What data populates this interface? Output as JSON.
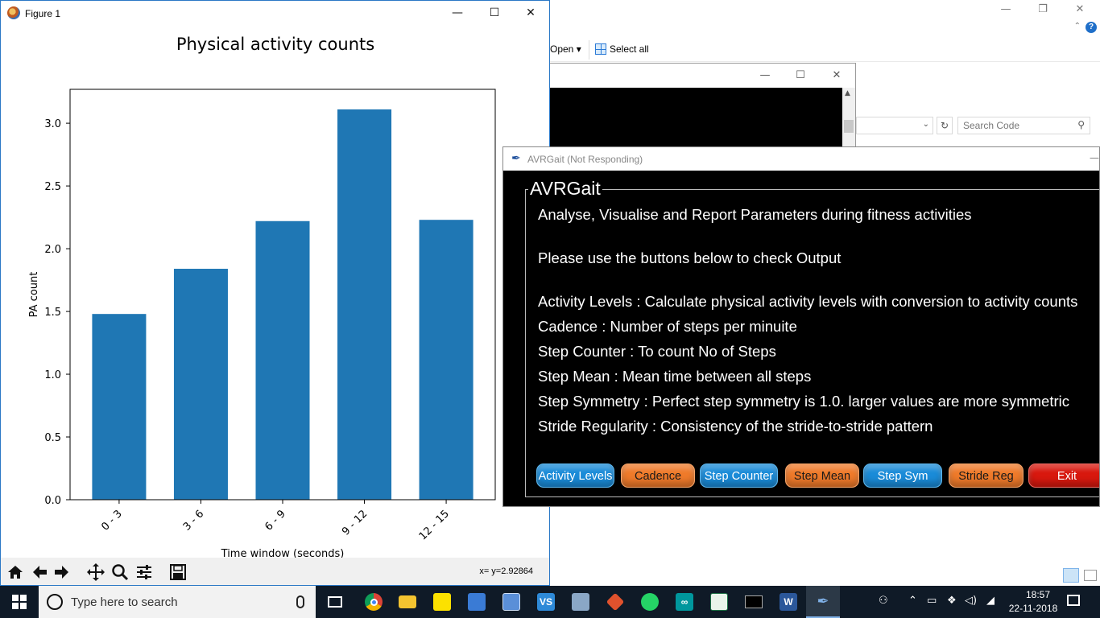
{
  "explorer": {
    "ribbon_open": "Open ▾",
    "ribbon_select_all": "Select all",
    "search_placeholder": "Search Code"
  },
  "figure": {
    "title": "Figure 1",
    "coord_readout": "x= y=2.92864",
    "toolbar": [
      "home-icon",
      "back-arrow-icon",
      "forward-arrow-icon",
      "pan-icon",
      "zoom-icon",
      "configure-subplots-icon",
      "save-icon"
    ]
  },
  "chart_data": {
    "type": "bar",
    "title": "Physical activity counts",
    "xlabel": "Time window (seconds)",
    "ylabel": "PA count",
    "categories": [
      "0 - 3",
      "3 - 6",
      "6 - 9",
      "9 - 12",
      "12 - 15"
    ],
    "values": [
      1.48,
      1.84,
      2.22,
      3.11,
      2.23
    ],
    "yticks": [
      "0.0",
      "0.5",
      "1.0",
      "1.5",
      "2.0",
      "2.5",
      "3.0"
    ],
    "ylim": [
      0,
      3.27
    ],
    "bar_color": "#1f77b4",
    "grid": false,
    "legend": "none"
  },
  "avrgait": {
    "window_title": "AVRGait (Not Responding)",
    "frame_title": "AVRGait",
    "lines": [
      "Analyse, Visualise and Report Parameters during fitness activities",
      "Please use the buttons below to check Output",
      "Activity Levels : Calculate physical activity levels with conversion to activity counts",
      "Cadence : Number of steps per minuite",
      "Step Counter : To count No of Steps",
      "Step Mean : Mean time between all steps",
      "Step Symmetry : Perfect step symmetry is 1.0. larger values are more symmetric",
      "Stride Regularity : Consistency of the stride-to-stride pattern"
    ],
    "buttons": [
      "Activity Levels",
      "Cadence",
      "Step Counter",
      "Step Mean",
      "Step Sym",
      "Stride Reg",
      "Exit"
    ],
    "colors": {
      "blue": "#1a8bd8",
      "orange": "#ef7a2a",
      "red": "#d8180e"
    }
  },
  "taskbar": {
    "search_placeholder": "Type here to search",
    "time": "18:57",
    "date": "22-11-2018",
    "apps": [
      "task-view-icon",
      "chrome-icon",
      "file-explorer-icon",
      "sticky-notes-icon",
      "network-app-icon",
      "photos-icon",
      "vs-icon",
      "tools-icon",
      "git-icon",
      "whatsapp-icon",
      "arduino-icon",
      "excel-file-icon",
      "command-prompt-icon",
      "word-icon",
      "python-feather-icon"
    ]
  }
}
